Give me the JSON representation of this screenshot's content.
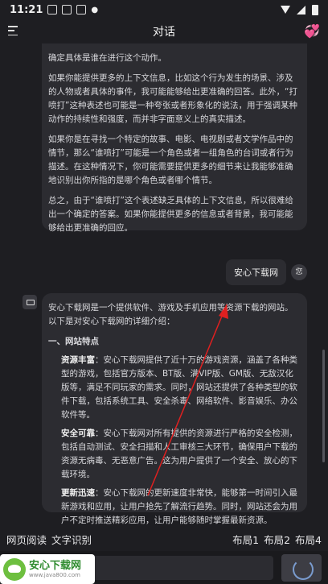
{
  "status_bar": {
    "time": "11:21",
    "icons": [
      "message-icon",
      "a-icon",
      "sd-icon",
      "dot-icon",
      "wifi-icon",
      "signal-icon",
      "battery-icon"
    ]
  },
  "header": {
    "title": "对话",
    "menu_icon": "menu-icon",
    "right_icon": "hearts-icon"
  },
  "chat": {
    "previous_answer": {
      "paragraphs": [
        "确定具体是谁在进行这个动作。",
        "如果你能提供更多的上下文信息，比如这个行为发生的场景、涉及的人物或者具体的事件，我可能能够给出更准确的回答。此外，“打喷打”这种表述也可能是一种夸张或者形象化的说法，用于强调某种动作的持续性和强度，而并非字面意义上的真实描述。",
        "如果你是在寻找一个特定的故事、电影、电视剧或者文学作品中的情节，那么“谁喷打”可能是一个角色或者一组角色的台词或者行为描述。在这种情况下，你可能需要提供更多的细节来让我能够准确地识别出你所指的是哪个角色或者哪个情节。",
        "总之，由于“谁喷打”这个表述缺乏具体的上下文信息，所以很难给出一个确定的答案。如果你能提供更多的信息或者背景，我可能能够给出更准确的回应。"
      ]
    },
    "user_message": {
      "text": "安心下载网",
      "avatar_label": "您"
    },
    "bot_answer": {
      "intro": "安心下载网是一个提供软件、游戏及手机应用等资源下载的网站。以下是对安心下载网的详细介绍：",
      "section_title": "一、网站特点",
      "items": [
        {
          "label": "资源丰富",
          "text": "：安心下载网提供了近十万的游戏资源，涵盖了各种类型的游戏，包括官方版本、BT版、满VIP版、GM版、无敌汉化版等，满足不同玩家的需求。同时，网站还提供了各种类型的软件下载，包括系统工具、安全杀毒、网络软件、影音娱乐、办公软件等。"
        },
        {
          "label": "安全可靠",
          "text": "：安心下载网对所有提供的资源进行严格的安全检测，包括自动测试、安全扫描和人工审核三大环节，确保用户下载的资源无病毒、无恶意广告。这为用户提供了一个安全、放心的下载环境。"
        },
        {
          "label": "更新迅速",
          "text": "：安心下载网的更新速度非常快，能够第一时间引入最新游戏和应用，让用户抢先了解流行趋势。同时，网站还会为用户不定时推送精彩应用，让用户能够随时掌握最新资源。"
        }
      ]
    }
  },
  "bottom_bar": {
    "left": [
      "网页阅读",
      "文字识别"
    ],
    "right": [
      "布局1",
      "布局2",
      "布局4"
    ]
  },
  "watermark": {
    "name": "安心下载网",
    "url": "www.java800.com"
  },
  "colors": {
    "background": "#1e1e22",
    "bubble": "#2c2c31",
    "arrow": "#e02020",
    "watermark_green": "#2e8b2e"
  }
}
